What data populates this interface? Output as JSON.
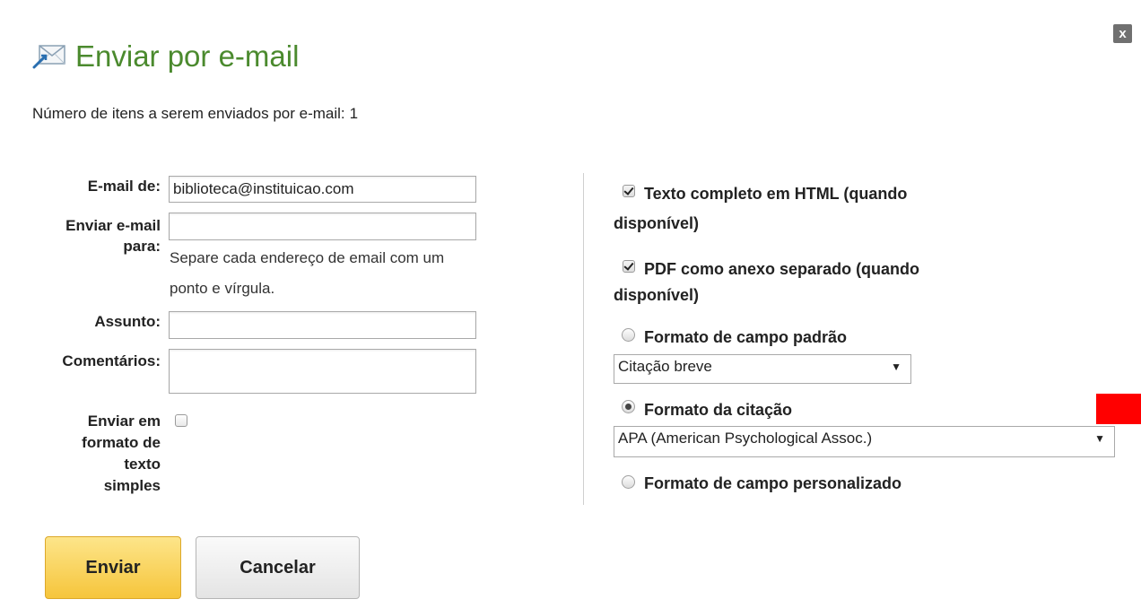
{
  "dialog": {
    "close_label": "x",
    "title": "Enviar por e-mail",
    "title_icon": "email-envelope-icon",
    "accent_color": "#4b8a2e"
  },
  "count": {
    "label": "Número de itens a serem enviados por e-mail:",
    "value": "1"
  },
  "form": {
    "from_label": "E-mail de:",
    "from_value": "biblioteca@instituicao.com",
    "to_label_line1": "Enviar e-mail",
    "to_label_line2": "para:",
    "to_value": "",
    "to_hint_line1": "Separe cada endereço de email com um",
    "to_hint_line2": "ponto e vírgula.",
    "subject_label": "Assunto:",
    "subject_value": "",
    "comments_label": "Comentários:",
    "comments_value": "",
    "plaintext_label_lines": [
      "Enviar em",
      "formato de",
      "texto",
      "simples"
    ],
    "plaintext_checked": false
  },
  "options": {
    "html_fulltext": {
      "label_line1": "Texto completo em HTML (quando",
      "label_line2": "disponível)",
      "checked": true
    },
    "pdf_attachment": {
      "label_line1": "PDF como anexo separado (quando",
      "label_line2": "disponível)",
      "checked": true
    },
    "standard_field_format": {
      "label": "Formato de campo padrão",
      "selected": false,
      "select_value": "Citação breve"
    },
    "citation_format": {
      "label": "Formato da citação",
      "selected": true,
      "select_value": "APA (American Psychological Assoc.)"
    },
    "custom_field_format": {
      "label": "Formato de campo personalizado",
      "selected": false
    }
  },
  "buttons": {
    "send": "Enviar",
    "cancel": "Cancelar"
  },
  "colors": {
    "primary_button": "#f6c53b",
    "marker": "#ff0000"
  }
}
